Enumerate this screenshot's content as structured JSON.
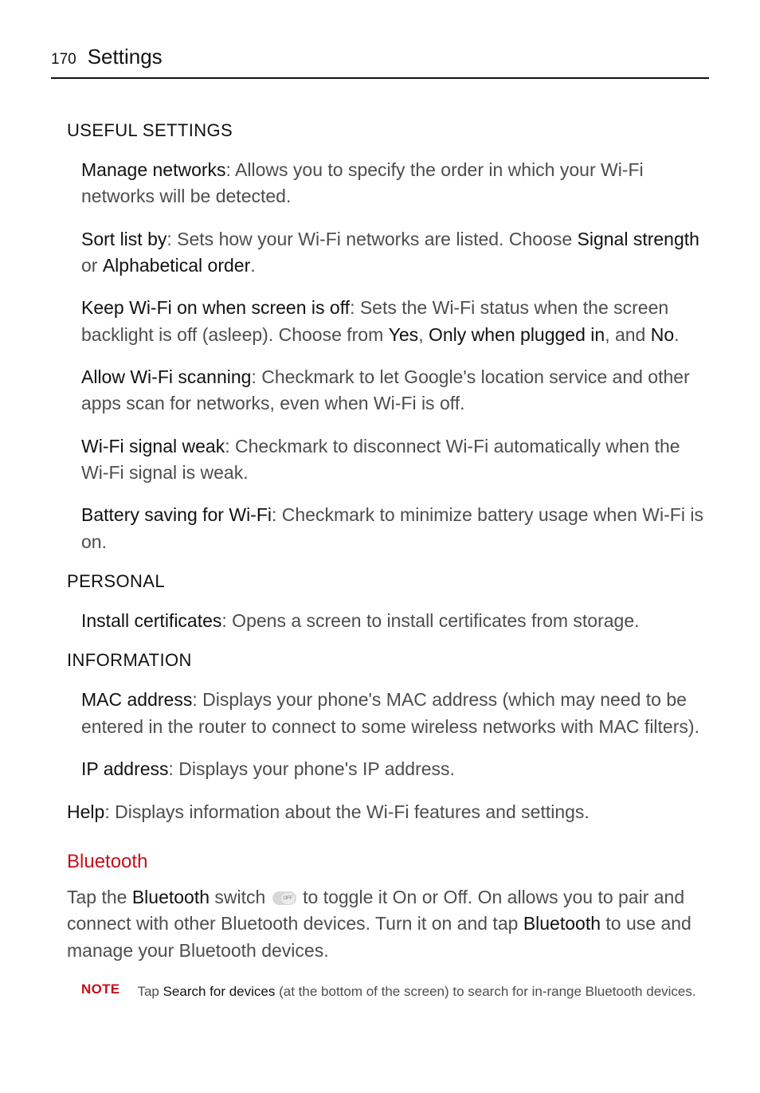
{
  "header": {
    "page_number": "170",
    "section": "Settings"
  },
  "useful_settings": {
    "heading": "USEFUL SETTINGS",
    "items": {
      "manage_networks": {
        "label": "Manage networks",
        "desc": ": Allows you to specify the order in which your Wi-Fi networks will be detected."
      },
      "sort_list_by": {
        "label": "Sort list by",
        "d1": ": Sets how your Wi-Fi networks are listed. Choose ",
        "o1": "Signal strength",
        "d2": " or ",
        "o2": "Alphabetical order",
        "d3": "."
      },
      "keep_wifi_on": {
        "label": "Keep Wi-Fi on when screen is off",
        "d1": ": Sets the Wi-Fi status when the screen backlight is off (asleep). Choose from ",
        "o1": "Yes",
        "d2": ", ",
        "o2": "Only when plugged in",
        "d3": ", and ",
        "o3": "No",
        "d4": "."
      },
      "allow_scan": {
        "label": "Allow Wi-Fi scanning",
        "desc": ": Checkmark to let Google's location service and other apps scan for networks, even when Wi-Fi is off."
      },
      "signal_weak": {
        "label": "Wi-Fi signal weak",
        "desc": ": Checkmark to disconnect Wi-Fi automatically when the Wi-Fi signal is weak."
      },
      "battery_saving": {
        "label": "Battery saving for Wi-Fi",
        "desc": ": Checkmark to minimize battery usage when Wi-Fi is on."
      }
    }
  },
  "personal": {
    "heading": "PERSONAL",
    "install_certs": {
      "label": "Install certificates",
      "desc": ": Opens a screen to install certificates from storage."
    }
  },
  "information": {
    "heading": "INFORMATION",
    "mac": {
      "label": "MAC address",
      "desc": ": Displays your phone's MAC address (which may need to be entered in the router to connect to some wireless networks with MAC filters)."
    },
    "ip": {
      "label": "IP address",
      "desc": ": Displays your phone's IP address."
    }
  },
  "help": {
    "label": "Help",
    "desc": ": Displays information about the Wi-Fi features and settings."
  },
  "bluetooth": {
    "heading": "Bluetooth",
    "p1_a": "Tap the ",
    "p1_b_bold": "Bluetooth",
    "p1_c": " switch ",
    "p1_d": " to toggle it On or Off. On allows you to pair and connect with other Bluetooth devices. Turn it on and tap ",
    "p1_e_bold": "Bluetooth",
    "p1_f": " to use and manage your Bluetooth devices.",
    "note_label": "NOTE",
    "note_a": "Tap ",
    "note_b_bold": "Search for devices",
    "note_c": " (at the bottom of the screen) to search for in-range Bluetooth devices."
  }
}
